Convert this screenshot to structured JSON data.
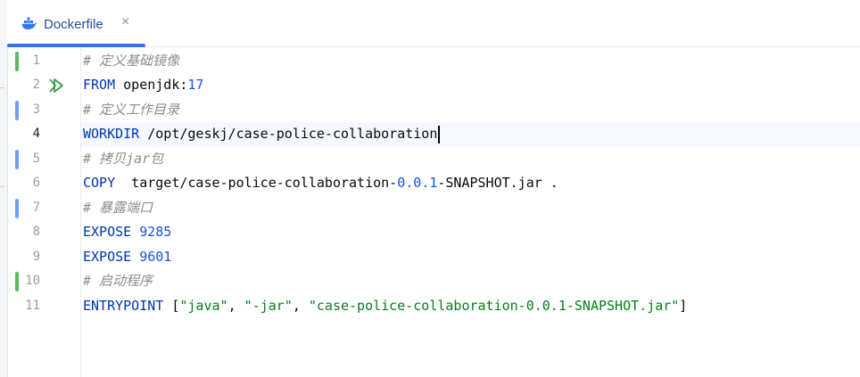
{
  "tab": {
    "file_name": "Dockerfile",
    "close_glyph": "×",
    "icon": "docker-whale-icon"
  },
  "colors": {
    "accent": "#3574f0",
    "change_added": "#5fb865",
    "change_modified": "#6f9ff0",
    "keyword": "#0033b3",
    "comment": "#8c8c8c",
    "number": "#1750eb",
    "string": "#067d17"
  },
  "editor": {
    "current_line": 4,
    "lines": [
      {
        "num": "1",
        "change": "added",
        "run": false,
        "tokens": [
          {
            "t": "# 定义基础镜像",
            "k": "comment"
          }
        ]
      },
      {
        "num": "2",
        "change": "",
        "run": true,
        "tokens": [
          {
            "t": "FROM",
            "k": "kw"
          },
          {
            "t": " openjdk:",
            "k": "plain"
          },
          {
            "t": "17",
            "k": "num"
          }
        ]
      },
      {
        "num": "3",
        "change": "modified",
        "run": false,
        "tokens": [
          {
            "t": "# 定义工作目录",
            "k": "comment"
          }
        ]
      },
      {
        "num": "4",
        "change": "",
        "run": false,
        "tokens": [
          {
            "t": "WORKDIR",
            "k": "kw"
          },
          {
            "t": " /opt/geskj/case-police-collaboration",
            "k": "plain"
          }
        ]
      },
      {
        "num": "5",
        "change": "modified",
        "run": false,
        "tokens": [
          {
            "t": "# 拷贝jar包",
            "k": "comment"
          }
        ]
      },
      {
        "num": "6",
        "change": "",
        "run": false,
        "tokens": [
          {
            "t": "COPY",
            "k": "kw"
          },
          {
            "t": "  target/case-police-collaboration-",
            "k": "plain"
          },
          {
            "t": "0.0.1",
            "k": "num"
          },
          {
            "t": "-SNAPSHOT.jar .",
            "k": "plain"
          }
        ]
      },
      {
        "num": "7",
        "change": "modified",
        "run": false,
        "tokens": [
          {
            "t": "# 暴露端口",
            "k": "comment"
          }
        ]
      },
      {
        "num": "8",
        "change": "",
        "run": false,
        "tokens": [
          {
            "t": "EXPOSE",
            "k": "kw"
          },
          {
            "t": " ",
            "k": "plain"
          },
          {
            "t": "9285",
            "k": "num"
          }
        ]
      },
      {
        "num": "9",
        "change": "",
        "run": false,
        "tokens": [
          {
            "t": "EXPOSE",
            "k": "kw"
          },
          {
            "t": " ",
            "k": "plain"
          },
          {
            "t": "9601",
            "k": "num"
          }
        ]
      },
      {
        "num": "10",
        "change": "added",
        "run": false,
        "tokens": [
          {
            "t": "# 启动程序",
            "k": "comment"
          }
        ]
      },
      {
        "num": "11",
        "change": "",
        "run": false,
        "tokens": [
          {
            "t": "ENTRYPOINT",
            "k": "kw"
          },
          {
            "t": " [",
            "k": "plain"
          },
          {
            "t": "\"java\"",
            "k": "str"
          },
          {
            "t": ", ",
            "k": "plain"
          },
          {
            "t": "\"-jar\"",
            "k": "str"
          },
          {
            "t": ", ",
            "k": "plain"
          },
          {
            "t": "\"case-police-collaboration-0.0.1-SNAPSHOT.jar\"",
            "k": "str"
          },
          {
            "t": "]",
            "k": "plain"
          }
        ]
      }
    ]
  }
}
